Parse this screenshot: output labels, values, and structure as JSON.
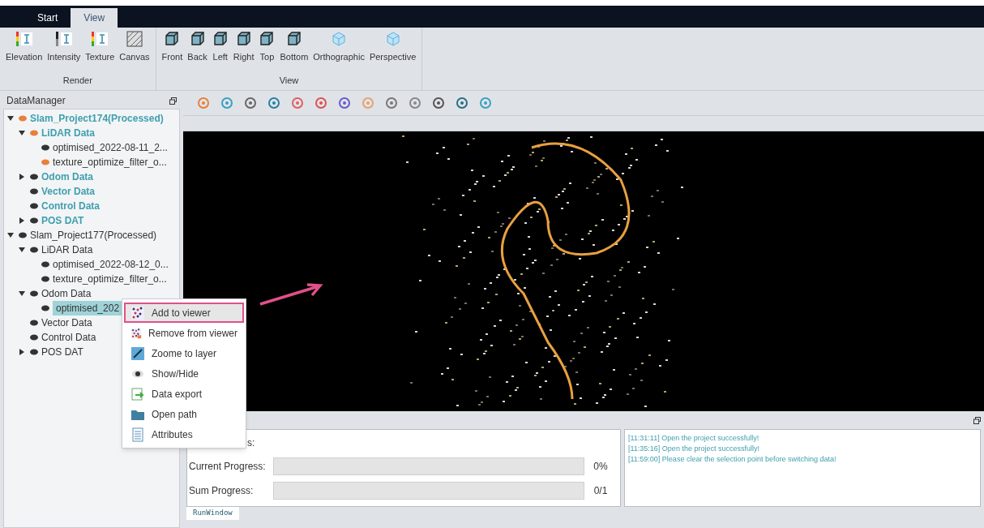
{
  "tabs": [
    {
      "label": "Start",
      "selected": false
    },
    {
      "label": "View",
      "selected": true
    }
  ],
  "ribbon_groups": [
    {
      "label": "Render",
      "buttons": [
        {
          "label": "Elevation",
          "kind": "elevation"
        },
        {
          "label": "Intensity",
          "kind": "intensity"
        },
        {
          "label": "Texture",
          "kind": "texture"
        },
        {
          "label": "Canvas",
          "kind": "canvas"
        }
      ]
    },
    {
      "label": "View",
      "buttons": [
        {
          "label": "Front",
          "kind": "cube"
        },
        {
          "label": "Back",
          "kind": "cube"
        },
        {
          "label": "Left",
          "kind": "cube"
        },
        {
          "label": "Right",
          "kind": "cube"
        },
        {
          "label": "Top",
          "kind": "cube"
        },
        {
          "label": "Bottom",
          "kind": "cube"
        },
        {
          "label": "Orthographic",
          "kind": "cube3d"
        },
        {
          "label": "Perspective",
          "kind": "cube3d"
        }
      ]
    }
  ],
  "data_manager": {
    "title": "DataManager",
    "tree": [
      {
        "label": "Slam_Project174(Processed)",
        "active": true,
        "expanded": true,
        "color": "#e8803a",
        "selected": false,
        "children": [
          {
            "label": "LiDAR Data",
            "active": true,
            "expanded": true,
            "color": "#e8803a",
            "selected": false,
            "children": [
              {
                "label": "optimised_2022-08-11_2...",
                "active": false,
                "color": "#333333",
                "selected": false
              },
              {
                "label": "texture_optimize_filter_o...",
                "active": false,
                "color": "#e8803a",
                "selected": false
              }
            ]
          },
          {
            "label": "Odom Data",
            "active": true,
            "expanded": false,
            "color": "#333333",
            "selected": false
          },
          {
            "label": "Vector Data",
            "active": true,
            "color": "#333333",
            "selected": false
          },
          {
            "label": "Control Data",
            "active": true,
            "color": "#333333",
            "selected": false
          },
          {
            "label": "POS DAT",
            "active": true,
            "expanded": false,
            "color": "#333333",
            "selected": false
          }
        ]
      },
      {
        "label": "Slam_Project177(Processed)",
        "active": false,
        "expanded": true,
        "color": "#333333",
        "selected": false,
        "children": [
          {
            "label": "LiDAR Data",
            "active": false,
            "expanded": true,
            "color": "#333333",
            "selected": false,
            "children": [
              {
                "label": "optimised_2022-08-12_0...",
                "active": false,
                "color": "#333333",
                "selected": false
              },
              {
                "label": "texture_optimize_filter_o...",
                "active": false,
                "color": "#333333",
                "selected": false
              }
            ]
          },
          {
            "label": "Odom Data",
            "active": false,
            "expanded": true,
            "color": "#333333",
            "selected": false,
            "children": [
              {
                "label": "optimised_202",
                "active": false,
                "color": "#333333",
                "selected": true
              }
            ]
          },
          {
            "label": "Vector Data",
            "active": false,
            "color": "#333333",
            "selected": false
          },
          {
            "label": "Control Data",
            "active": false,
            "color": "#333333",
            "selected": false
          },
          {
            "label": "POS DAT",
            "active": false,
            "expanded": false,
            "color": "#333333",
            "selected": false
          }
        ]
      }
    ]
  },
  "context_menu": [
    {
      "label": "Add to viewer",
      "kind": "add",
      "selected": true
    },
    {
      "label": "Remove from viewer",
      "kind": "remove",
      "selected": false
    },
    {
      "label": "Zoome to layer",
      "kind": "zoom",
      "selected": false
    },
    {
      "label": "Show/Hide",
      "kind": "eye",
      "selected": false
    },
    {
      "label": "Data export",
      "kind": "export",
      "selected": false
    },
    {
      "label": "Open path",
      "kind": "folder",
      "selected": false
    },
    {
      "label": "Attributes",
      "kind": "attributes",
      "selected": false
    }
  ],
  "run_window": {
    "current_status": "s:",
    "current_progress": {
      "label": "Current Progress:",
      "level": 0,
      "reading": "0%"
    },
    "sum_progress": {
      "label": "Sum Progress:",
      "level": 0,
      "reading": "0/1"
    },
    "log": [
      "[11:31:11] Open the project successfully!",
      "[11:35:16] Open the project successfully!",
      "[11:59:00] Please clear the selection point before switching data!"
    ],
    "tab": "RunWindow"
  }
}
